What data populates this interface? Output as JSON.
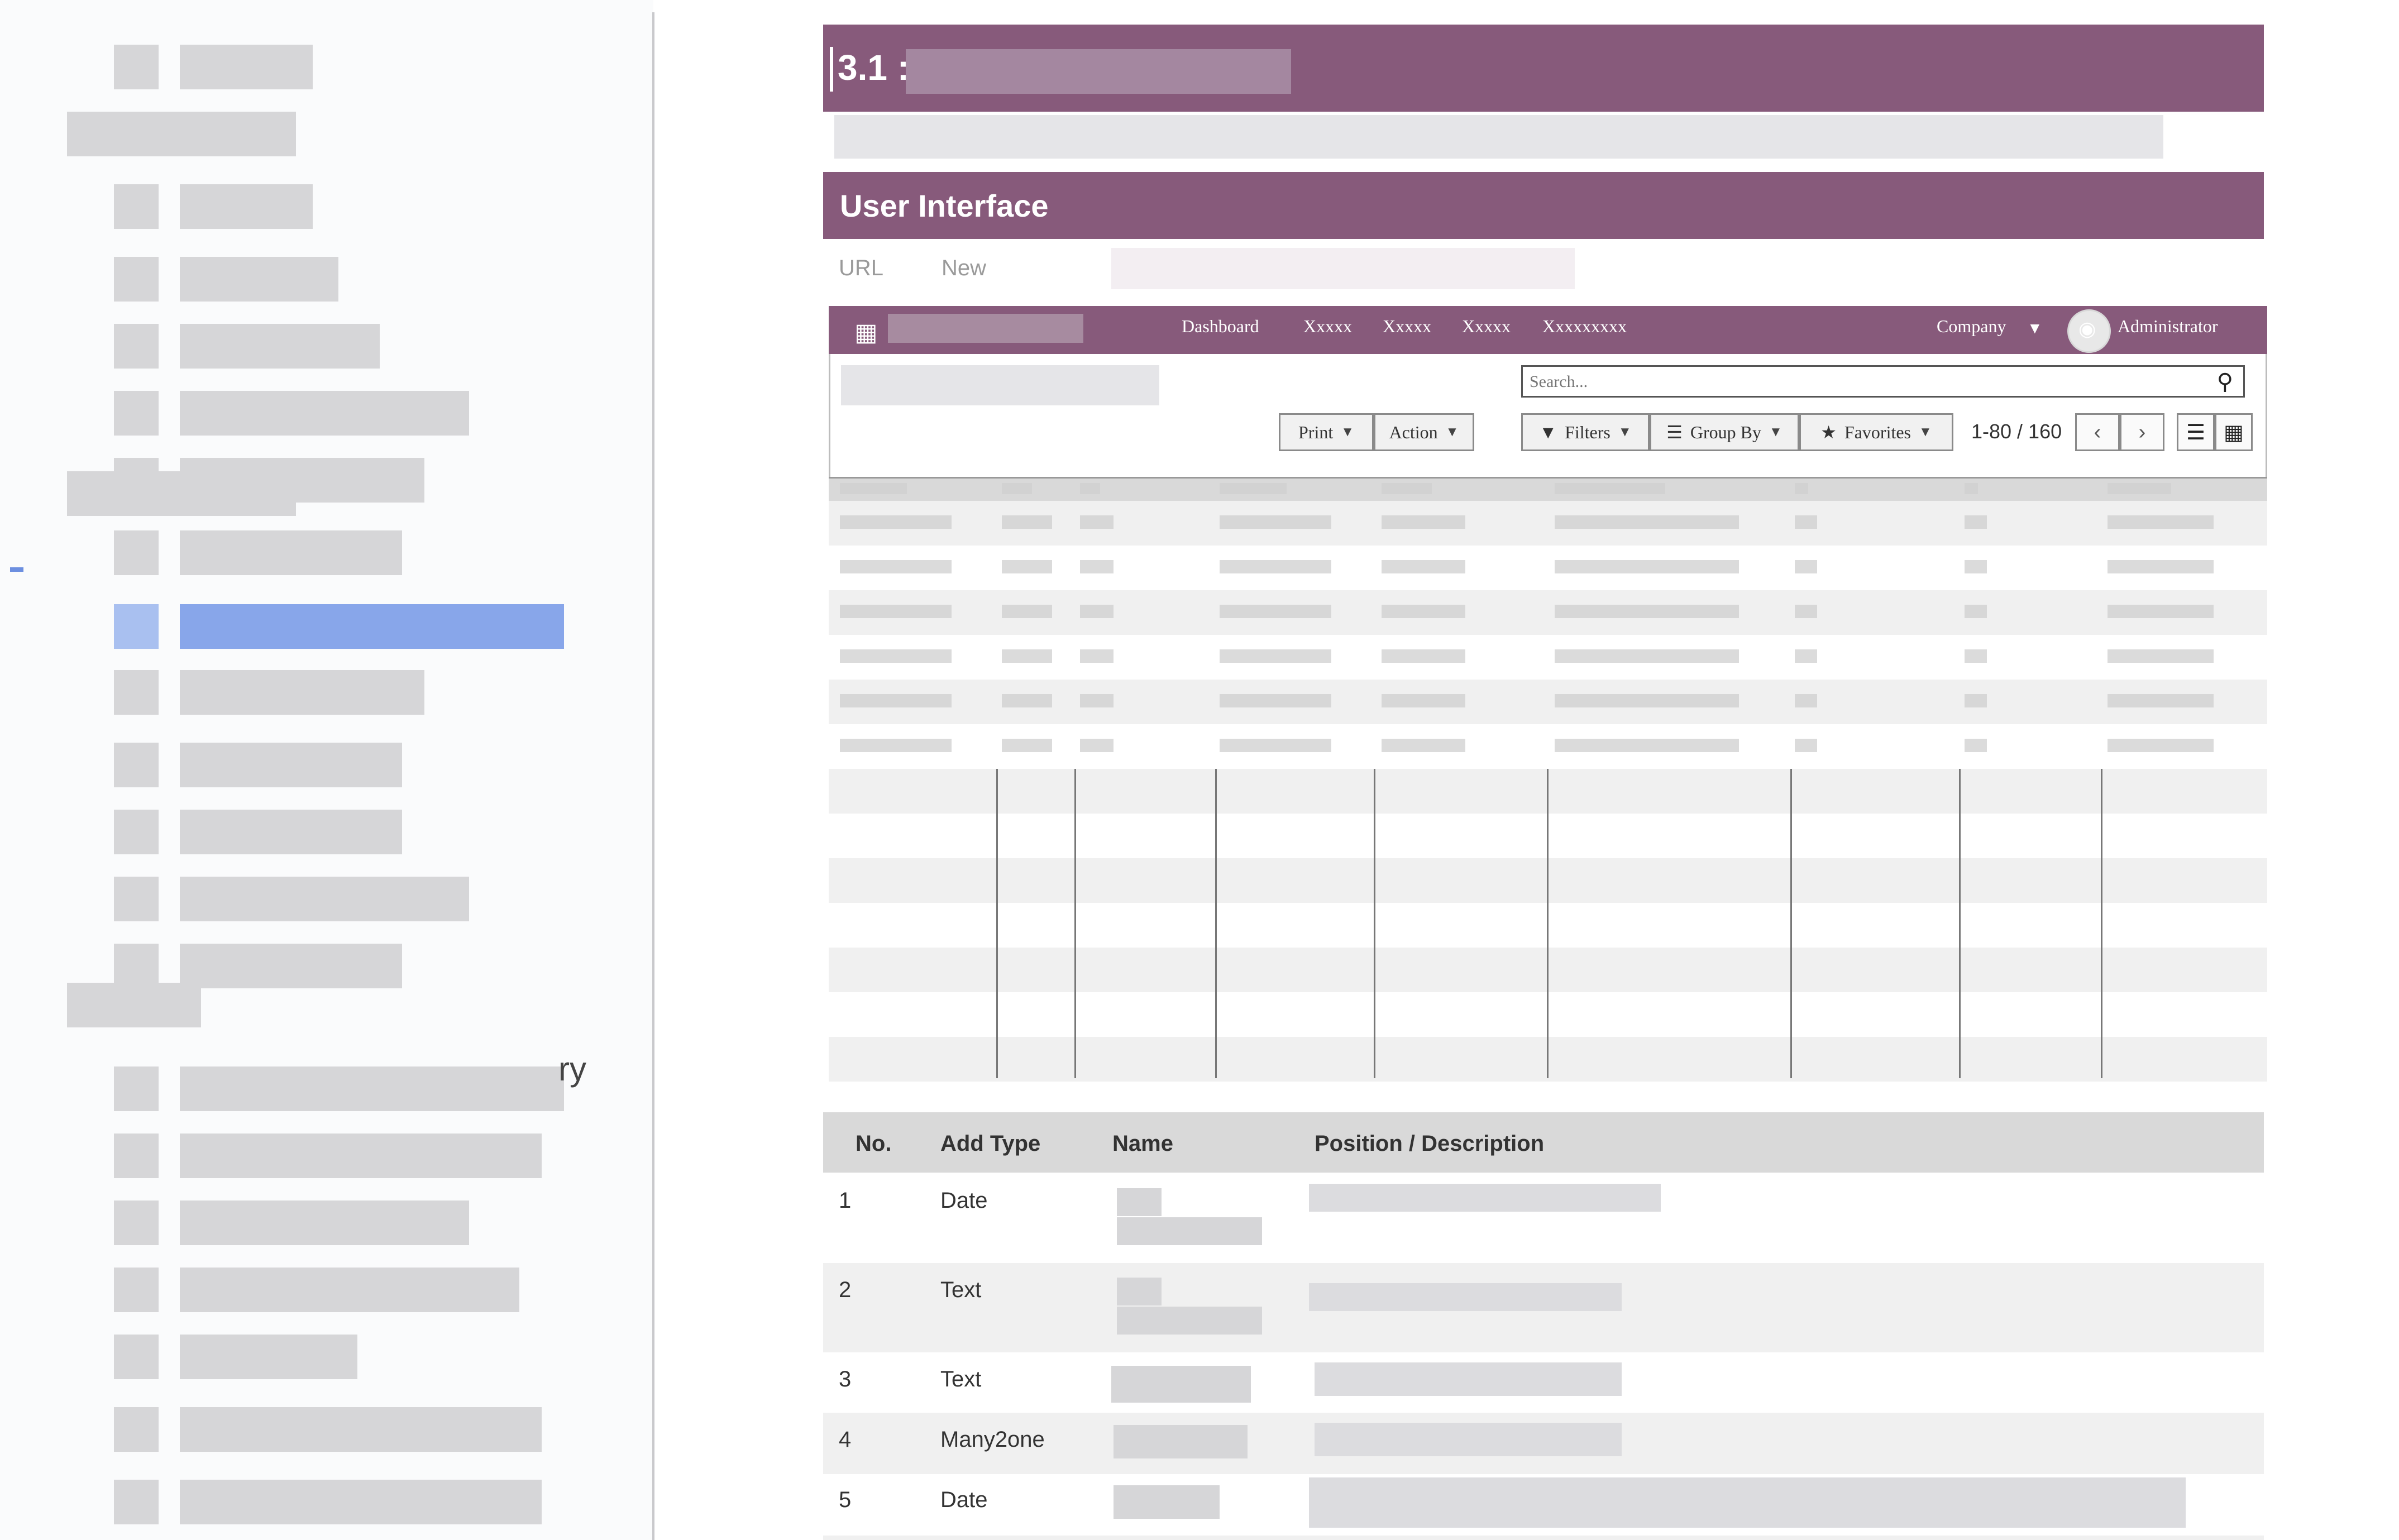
{
  "sidebar": {
    "tail_text": "ry"
  },
  "doc": {
    "section_number": "3.1 :",
    "section_heading": "User Interface",
    "url_label": "URL",
    "url_value": "New"
  },
  "odoo": {
    "nav_links": [
      "Dashboard",
      "Xxxxx",
      "Xxxxx",
      "Xxxxx",
      "Xxxxxxxxx"
    ],
    "company": "Company",
    "user": "Administrator",
    "search_placeholder": "Search...",
    "print_label": "Print",
    "action_label": "Action",
    "filters_label": "Filters",
    "groupby_label": "Group By",
    "favorites_label": "Favorites",
    "pager": "1-80 / 160",
    "icons": {
      "apps": "apps-grid-icon",
      "avatar": "camera-icon",
      "search": "magnifier-icon",
      "filter": "funnel-icon",
      "groupby": "bars-icon",
      "favorites": "star-icon",
      "prev": "chevron-left-icon",
      "next": "chevron-right-icon",
      "list_view": "list-view-icon",
      "kanban_view": "kanban-view-icon"
    }
  },
  "fields_table": {
    "headers": [
      "No.",
      "Add Type",
      "Name",
      "Position / Description"
    ],
    "rows": [
      {
        "no": "1",
        "type": "Date"
      },
      {
        "no": "2",
        "type": "Text"
      },
      {
        "no": "3",
        "type": "Text"
      },
      {
        "no": "4",
        "type": "Many2one"
      },
      {
        "no": "5",
        "type": "Date"
      }
    ]
  },
  "colors": {
    "brand": "#875a7b",
    "header_gray": "#d9d9d9",
    "active_blue": "#6c8fe0"
  }
}
